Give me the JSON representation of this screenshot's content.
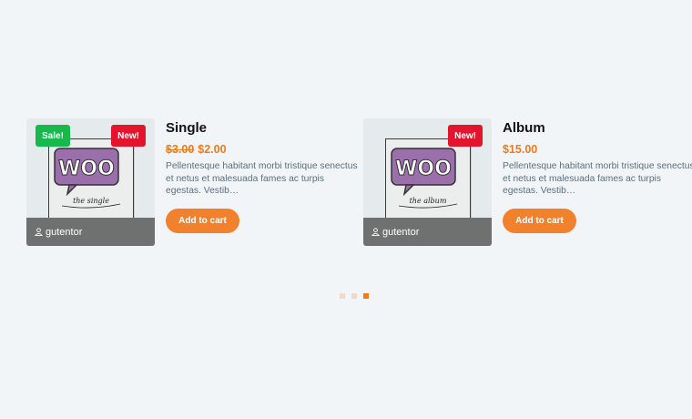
{
  "products": [
    {
      "title": "Single",
      "price_old": "$3.00",
      "price": "$2.00",
      "description": "Pellentesque habitant morbi tristique senectus et netus et malesuada fames ac turpis egestas. Vestib…",
      "button_label": "Add to cart",
      "author": "gutentor",
      "badge_sale": "Sale!",
      "badge_new": "New!",
      "image_logo": "WOO",
      "image_caption": "the single"
    },
    {
      "title": "Album",
      "price": "$15.00",
      "description": "Pellentesque habitant morbi tristique senectus et netus et malesuada fames ac turpis egestas. Vestib…",
      "button_label": "Add to cart",
      "author": "gutentor",
      "badge_new": "New!",
      "image_logo": "WOO",
      "image_caption": "the album"
    }
  ],
  "carousel": {
    "pages": 3,
    "active_index": 2
  },
  "colors": {
    "accent": "#ee7a1a",
    "sale_badge": "#17b94e",
    "new_badge": "#e2152c",
    "woo_purple": "#9b6fac"
  },
  "icons": {
    "author": "user-icon"
  }
}
